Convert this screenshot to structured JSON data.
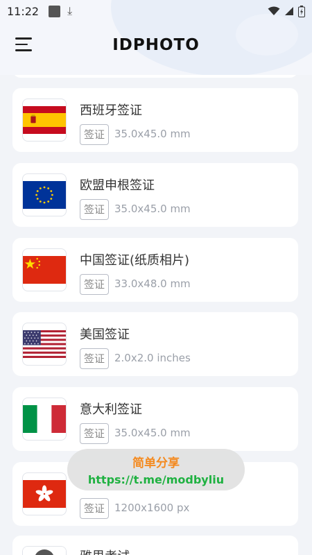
{
  "status_bar": {
    "time": "11:22",
    "icons": [
      "notification-square-icon",
      "download-icon",
      "wifi-icon",
      "signal-icon",
      "battery-icon"
    ]
  },
  "header": {
    "logo_text": "IDPHOTO",
    "menu_icon": "hamburger-menu-icon"
  },
  "items": [
    {
      "name": "西班牙签证",
      "tag": "签证",
      "size": "35.0x45.0 mm",
      "flag": "spain"
    },
    {
      "name": "欧盟申根签证",
      "tag": "签证",
      "size": "35.0x45.0 mm",
      "flag": "eu"
    },
    {
      "name": "中国签证(纸质相片)",
      "tag": "签证",
      "size": "33.0x48.0 mm",
      "flag": "china"
    },
    {
      "name": "美国签证",
      "tag": "签证",
      "size": "2.0x2.0 inches",
      "flag": "usa"
    },
    {
      "name": "意大利签证",
      "tag": "签证",
      "size": "35.0x45.0 mm",
      "flag": "italy"
    },
    {
      "name": "",
      "tag": "签证",
      "size": "1200x1600 px",
      "flag": "hongkong"
    },
    {
      "name": "雅思考试",
      "tag": "",
      "size": "",
      "flag": "avatar"
    }
  ],
  "toast": {
    "line1": "简单分享",
    "line2": "https://t.me/modbyliu"
  },
  "colors": {
    "background": "#f2f4f8",
    "card": "#ffffff",
    "toast_line1": "#f48a1f",
    "toast_line2": "#1fb141"
  }
}
